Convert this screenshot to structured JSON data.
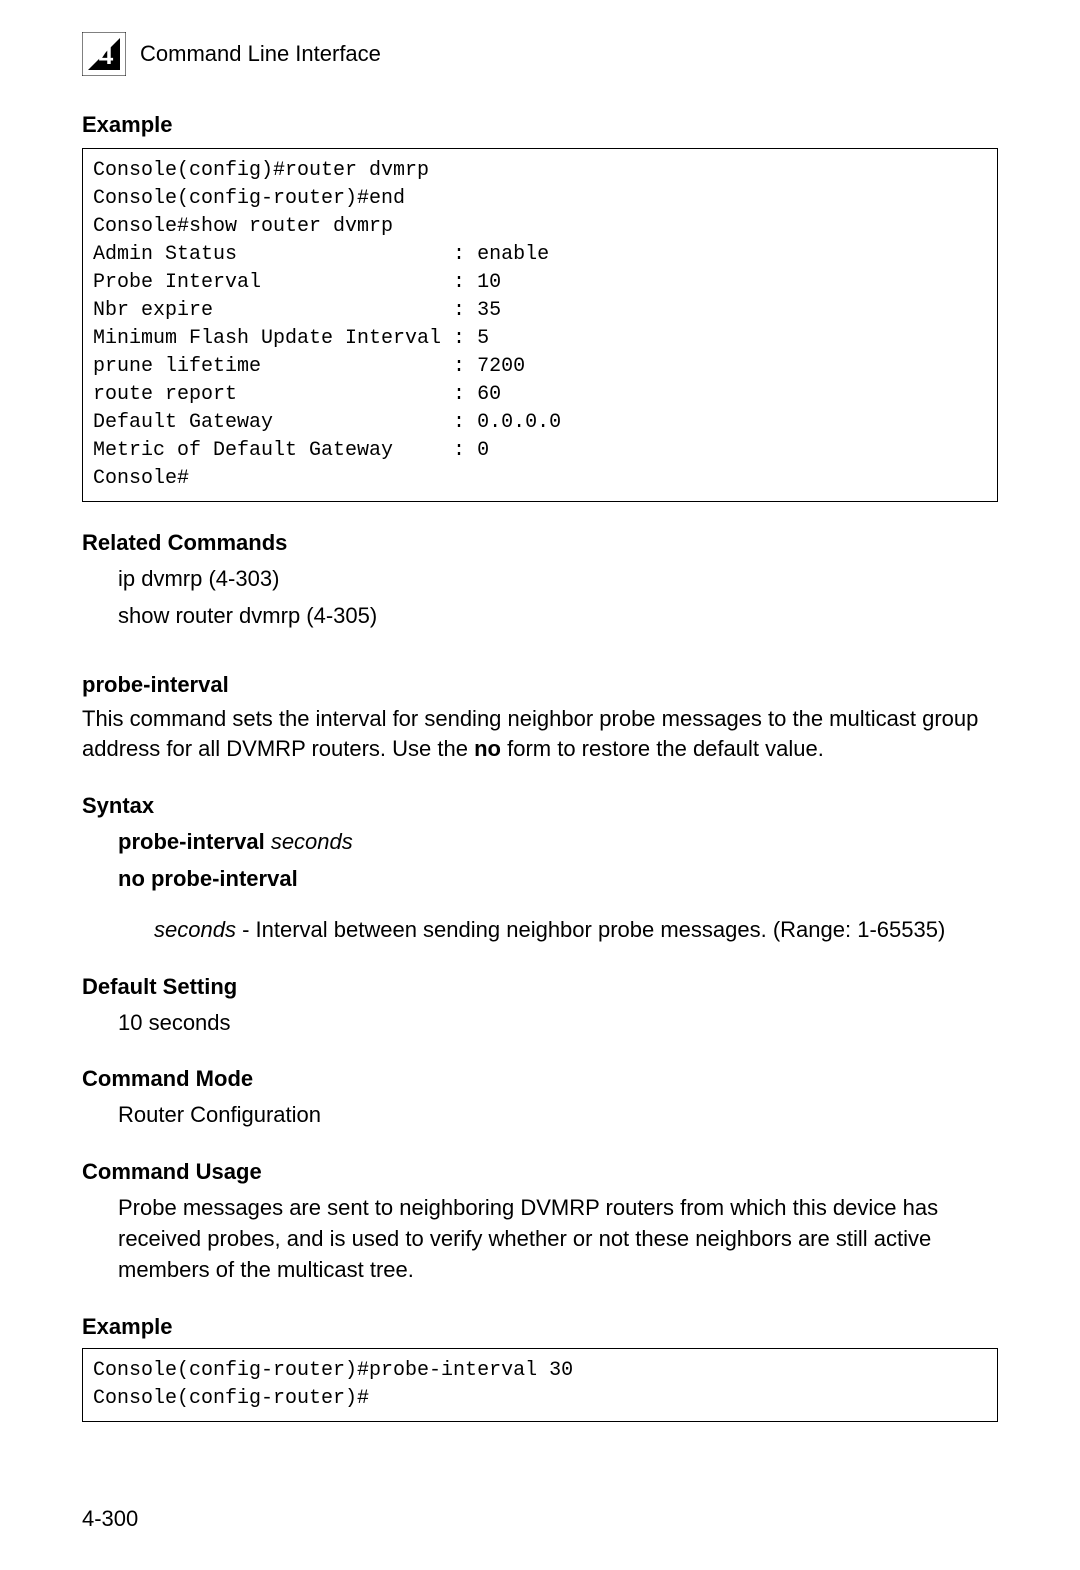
{
  "header": {
    "chapter_number": "4",
    "chapter_title": "Command Line Interface"
  },
  "example1": {
    "heading": "Example",
    "code": "Console(config)#router dvmrp\nConsole(config-router)#end\nConsole#show router dvmrp\nAdmin Status                  : enable\nProbe Interval                : 10\nNbr expire                    : 35\nMinimum Flash Update Interval : 5\nprune lifetime                : 7200\nroute report                  : 60\nDefault Gateway               : 0.0.0.0\nMetric of Default Gateway     : 0\nConsole#"
  },
  "related_commands": {
    "heading": "Related Commands",
    "items": [
      "ip dvmrp (4-303)",
      "show router dvmrp (4-305)"
    ]
  },
  "command": {
    "title": "probe-interval",
    "description_pre": "This command sets the interval for sending neighbor probe messages to the multicast group address for all DVMRP routers. Use the ",
    "description_bold": "no",
    "description_post": " form to restore the default value."
  },
  "syntax": {
    "heading": "Syntax",
    "line1_bold": "probe-interval ",
    "line1_italic": "seconds",
    "line2": "no probe-interval",
    "param_italic": "seconds",
    "param_desc": " - Interval between sending neighbor probe messages. (Range: 1-65535)"
  },
  "default_setting": {
    "heading": "Default Setting",
    "value": "10 seconds"
  },
  "command_mode": {
    "heading": "Command Mode",
    "value": "Router Configuration"
  },
  "command_usage": {
    "heading": "Command Usage",
    "value": "Probe messages are sent to neighboring DVMRP routers from which this device has received probes, and is used to verify whether or not these neighbors are still active members of the multicast tree."
  },
  "example2": {
    "heading": "Example",
    "code": "Console(config-router)#probe-interval 30\nConsole(config-router)#"
  },
  "page_number": "4-300"
}
